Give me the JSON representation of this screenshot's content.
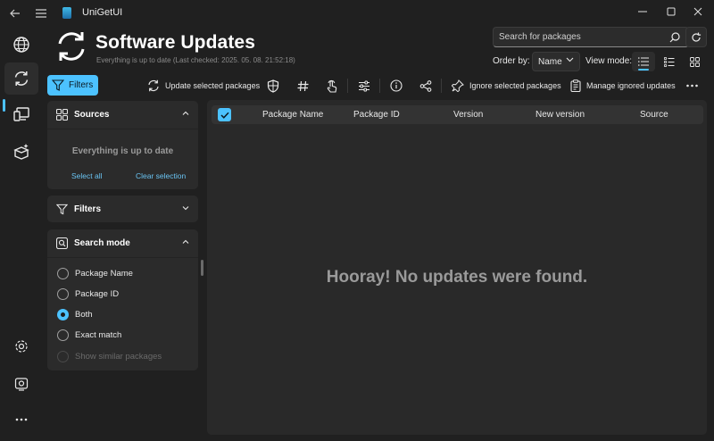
{
  "app": {
    "title": "UniGetUI"
  },
  "page": {
    "title": "Software Updates",
    "subtitle": "Everything is up to date (Last checked: 2025. 05. 08. 21:52:18)"
  },
  "search": {
    "placeholder": "Search for packages"
  },
  "order": {
    "label": "Order by:",
    "value": "Name"
  },
  "view_mode": {
    "label": "View mode:"
  },
  "toolbar": {
    "filters_label": "Filters",
    "update_selected": "Update selected packages",
    "ignore_selected": "Ignore selected packages",
    "manage_ignored": "Manage ignored updates"
  },
  "sources_panel": {
    "title": "Sources",
    "empty_text": "Everything is up to date",
    "select_all": "Select all",
    "clear_selection": "Clear selection"
  },
  "filters_panel": {
    "title": "Filters"
  },
  "search_mode_panel": {
    "title": "Search mode",
    "options": [
      {
        "label": "Package Name",
        "checked": false
      },
      {
        "label": "Package ID",
        "checked": false
      },
      {
        "label": "Both",
        "checked": true
      },
      {
        "label": "Exact match",
        "checked": false
      },
      {
        "label": "Show similar packages",
        "checked": false,
        "disabled": true
      }
    ]
  },
  "table": {
    "columns": [
      "Package Name",
      "Package ID",
      "Version",
      "New version",
      "Source"
    ]
  },
  "empty_state": {
    "message": "Hooray! No updates were found."
  },
  "colors": {
    "accent": "#4cc2ff",
    "background": "#202020",
    "panel": "#2b2b2b"
  }
}
